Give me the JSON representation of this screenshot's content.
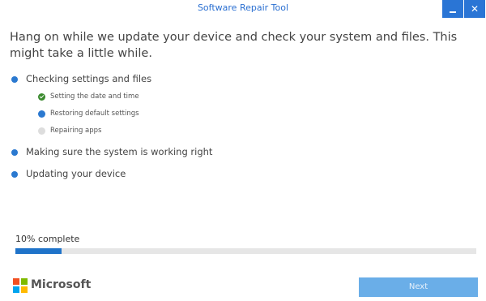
{
  "window": {
    "title": "Software Repair Tool",
    "minimize_icon": "minimize-icon",
    "close_glyph": "✕"
  },
  "heading": "Hang on while we update your device and check your system and files. This might take a little while.",
  "steps": [
    {
      "label": "Checking settings and files",
      "status": "in-progress",
      "substeps": [
        {
          "label": "Setting the date and time",
          "status": "done"
        },
        {
          "label": "Restoring default settings",
          "status": "in-progress"
        },
        {
          "label": "Repairing apps",
          "status": "pending"
        }
      ]
    },
    {
      "label": "Making sure the system is working right",
      "status": "pending"
    },
    {
      "label": "Updating your device",
      "status": "pending"
    }
  ],
  "progress": {
    "label": "10% complete",
    "fraction": 0.1
  },
  "footer": {
    "brand": "Microsoft",
    "next_label": "Next",
    "next_enabled": false
  },
  "colors": {
    "accent": "#2b79d0",
    "done": "#3a8a2e",
    "pending": "#dddddd",
    "button_disabled": "#6aaee8",
    "ms_red": "#f25022",
    "ms_green": "#7fba00",
    "ms_blue": "#00a4ef",
    "ms_yellow": "#ffb900"
  }
}
